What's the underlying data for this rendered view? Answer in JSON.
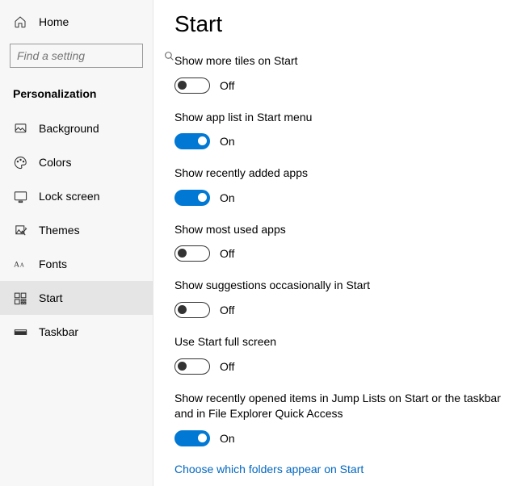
{
  "sidebar": {
    "home_label": "Home",
    "search_placeholder": "Find a setting",
    "section_header": "Personalization",
    "items": [
      {
        "label": "Background",
        "active": false
      },
      {
        "label": "Colors",
        "active": false
      },
      {
        "label": "Lock screen",
        "active": false
      },
      {
        "label": "Themes",
        "active": false
      },
      {
        "label": "Fonts",
        "active": false
      },
      {
        "label": "Start",
        "active": true
      },
      {
        "label": "Taskbar",
        "active": false
      }
    ]
  },
  "main": {
    "title": "Start",
    "settings": [
      {
        "label": "Show more tiles on Start",
        "state": "Off",
        "on": false
      },
      {
        "label": "Show app list in Start menu",
        "state": "On",
        "on": true
      },
      {
        "label": "Show recently added apps",
        "state": "On",
        "on": true
      },
      {
        "label": "Show most used apps",
        "state": "Off",
        "on": false
      },
      {
        "label": "Show suggestions occasionally in Start",
        "state": "Off",
        "on": false
      },
      {
        "label": "Use Start full screen",
        "state": "Off",
        "on": false
      },
      {
        "label": "Show recently opened items in Jump Lists on Start or the taskbar and in File Explorer Quick Access",
        "state": "On",
        "on": true
      }
    ],
    "link": "Choose which folders appear on Start"
  }
}
